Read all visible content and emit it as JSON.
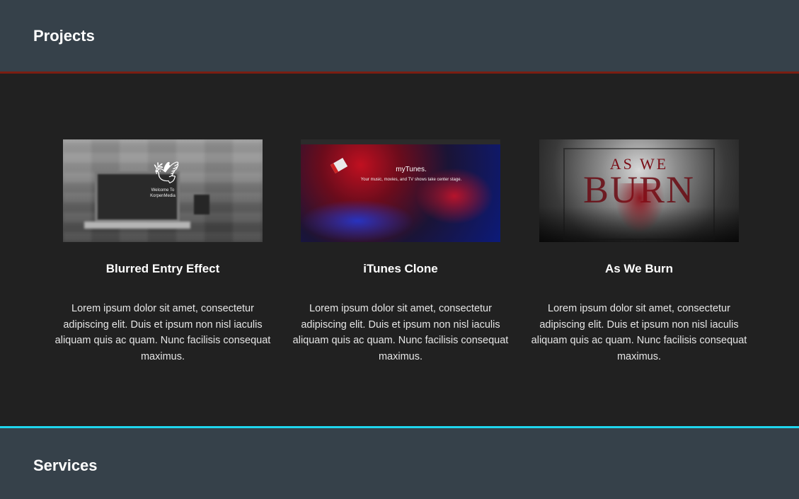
{
  "projects_section": {
    "title": "Projects"
  },
  "services_section": {
    "title": "Services"
  },
  "cards": [
    {
      "title": "Blurred Entry Effect",
      "description": "Lorem ipsum dolor sit amet, consectetur adipiscing elit. Duis et ipsum non nisl iaculis aliquam quis ac quam. Nunc facilisis consequat maximus.",
      "thumb_text": "Welcome To KorpenMedia"
    },
    {
      "title": "iTunes Clone",
      "description": "Lorem ipsum dolor sit amet, consectetur adipiscing elit. Duis et ipsum non nisl iaculis aliquam quis ac quam. Nunc facilisis consequat maximus.",
      "thumb_brand": "myTunes.",
      "thumb_tagline": "Your music, movies, and TV shows take center stage."
    },
    {
      "title": "As We Burn",
      "description": "Lorem ipsum dolor sit amet, consectetur adipiscing elit. Duis et ipsum non nisl iaculis aliquam quis ac quam. Nunc facilisis consequat maximus.",
      "thumb_logo_top": "AS WE",
      "thumb_logo_main": "BURN"
    }
  ],
  "colors": {
    "header_bg": "#36414a",
    "body_bg": "#212121",
    "projects_rule": "#7a1e12",
    "services_rule": "#1fd6ee"
  }
}
